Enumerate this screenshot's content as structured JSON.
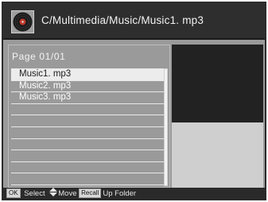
{
  "header": {
    "icon": "vinyl-disc-icon",
    "path": "C/Multimedia/Music/Music1. mp3"
  },
  "file_list": {
    "page_label": "Page 01/01",
    "items": [
      {
        "label": "Music1. mp3",
        "selected": true
      },
      {
        "label": "Music2. mp3",
        "selected": false
      },
      {
        "label": "Music3. mp3",
        "selected": false
      }
    ],
    "empty_rows": 7
  },
  "footer": {
    "ok_key": "OK",
    "select_label": "Select",
    "move_label": "Move",
    "recall_key": "Recall",
    "up_folder_label": "Up Folder"
  },
  "colors": {
    "header_bg": "#2e2e2e",
    "panel_bg": "#9a9a9a",
    "selected_row": "#ececec",
    "preview_bg": "#222222",
    "info_bg": "#cfcfcf"
  }
}
